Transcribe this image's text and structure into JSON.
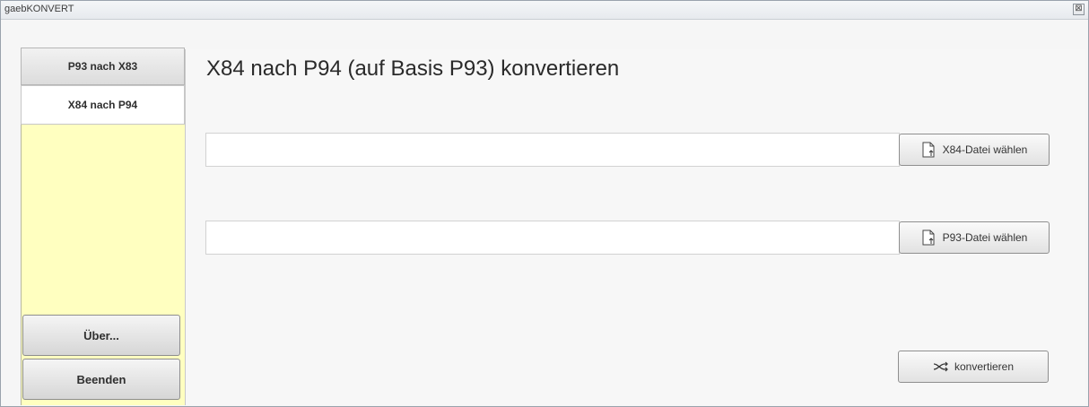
{
  "window": {
    "title": "gaebKONVERT",
    "close_glyph": "⊠"
  },
  "sidebar": {
    "background": "#ffffc0",
    "tabs": [
      {
        "label": "P93 nach X83",
        "selected": false
      },
      {
        "label": "X84 nach P94",
        "selected": true
      }
    ],
    "about_label": "Über...",
    "exit_label": "Beenden"
  },
  "main": {
    "heading": "X84 nach P94 (auf Basis P93) konvertieren",
    "x84_input": {
      "value": "",
      "placeholder": ""
    },
    "x84_button_label": "X84-Datei wählen",
    "x84_button_icon": "file-icon",
    "p93_input": {
      "value": "",
      "placeholder": ""
    },
    "p93_button_label": "P93-Datei wählen",
    "p93_button_icon": "file-icon",
    "convert_label": "konvertieren",
    "convert_icon": "shuffle-icon"
  }
}
